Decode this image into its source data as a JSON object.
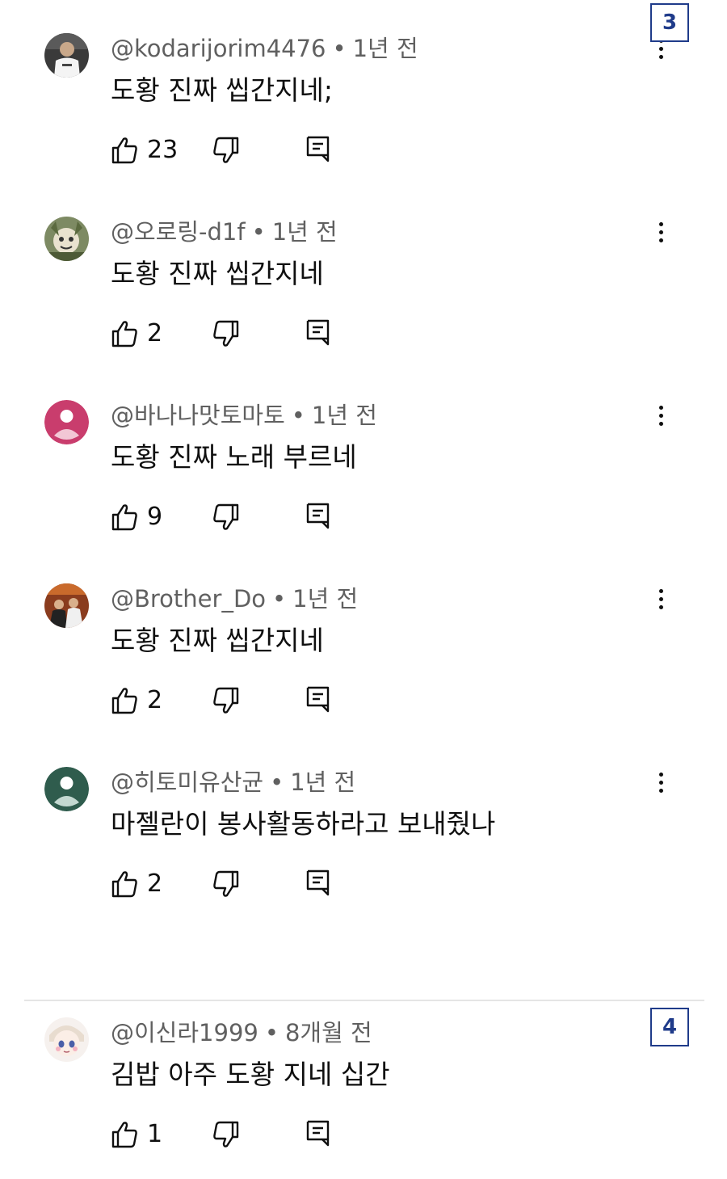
{
  "comments": [
    {
      "author": "@kodarijorim4476",
      "time": "1년 전",
      "text": "도황 진짜 씹간지네;",
      "likes": "23",
      "avatar_icon": "photo-avatar-person-white-shirt"
    },
    {
      "author": "@오로링-d1f",
      "time": "1년 전",
      "text": "도황 진짜 씹간지네",
      "likes": "2",
      "avatar_icon": "photo-avatar-character"
    },
    {
      "author": "@바나나맛토마토",
      "time": "1년 전",
      "text": "도황 진짜 노래 부르네",
      "likes": "9",
      "avatar_icon": "default-avatar-pink",
      "avatar_color": "#c93d6d"
    },
    {
      "author": "@Brother_Do",
      "time": "1년 전",
      "text": "도황 진짜 씹간지네",
      "likes": "2",
      "avatar_icon": "photo-avatar-group"
    },
    {
      "author": "@히토미유산균",
      "time": "1년 전",
      "text": "마젤란이 봉사활동하라고 보내줬나",
      "likes": "2",
      "avatar_icon": "default-avatar-green",
      "avatar_color": "#2f5c4d"
    },
    {
      "author": "@이신라1999",
      "time": "8개월 전",
      "text": "김밥 아주 도황 지네 십간",
      "likes": "1",
      "avatar_icon": "photo-avatar-anime"
    }
  ],
  "separator": "•",
  "markers": [
    "3",
    "4"
  ],
  "colors": {
    "meta_text": "#606060",
    "body_text": "#0f0f0f",
    "marker": "#1f3b8a"
  }
}
